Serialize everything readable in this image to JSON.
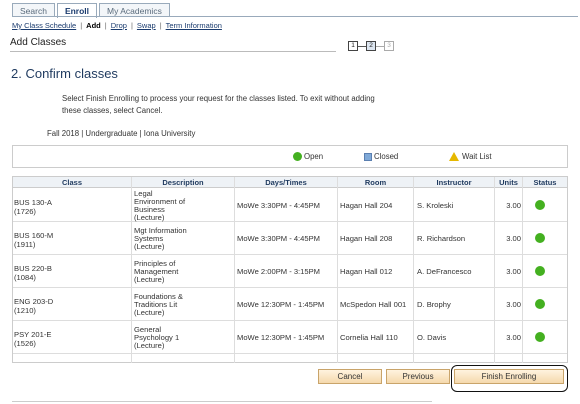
{
  "tabs": [
    {
      "label": "Search",
      "active": false
    },
    {
      "label": "Enroll",
      "active": true
    },
    {
      "label": "My Academics",
      "active": false
    }
  ],
  "subnav": [
    {
      "label": "My Class Schedule",
      "active": false
    },
    {
      "label": "Add",
      "active": true
    },
    {
      "label": "Drop",
      "active": false
    },
    {
      "label": "Swap",
      "active": false
    },
    {
      "label": "Term Information",
      "active": false
    }
  ],
  "page": {
    "section_title": "Add Classes",
    "steps": [
      "1",
      "2",
      "3"
    ],
    "current_step": 2,
    "heading": "2.  Confirm classes",
    "instructions": "Select Finish Enrolling to process your request for the classes listed. To exit without adding these classes, select Cancel.",
    "term": "Fall 2018 | Undergraduate | Iona University"
  },
  "legend": {
    "open": "Open",
    "closed": "Closed",
    "waitlist": "Wait List"
  },
  "table": {
    "headers": {
      "class": "Class",
      "description": "Description",
      "days_times": "Days/Times",
      "room": "Room",
      "instructor": "Instructor",
      "units": "Units",
      "status": "Status"
    },
    "rows": [
      {
        "class": "BUS 130-A",
        "class_id": "(1726)",
        "description": [
          "Legal",
          "Environment of",
          "Business",
          "(Lecture)"
        ],
        "days_times": "MoWe 3:30PM - 4:45PM",
        "room": "Hagan Hall 204",
        "instructor": "S. Kroleski",
        "units": "3.00",
        "status": "Open"
      },
      {
        "class": "BUS 160-M",
        "class_id": "(1911)",
        "description": [
          "Mgt Information",
          "Systems",
          "(Lecture)"
        ],
        "days_times": "MoWe 3:30PM - 4:45PM",
        "room": "Hagan Hall 208",
        "instructor": "R. Richardson",
        "units": "3.00",
        "status": "Open"
      },
      {
        "class": "BUS 220-B",
        "class_id": "(1084)",
        "description": [
          "Principles of",
          "Management",
          "(Lecture)"
        ],
        "days_times": "MoWe 2:00PM - 3:15PM",
        "room": "Hagan Hall 012",
        "instructor": "A. DeFrancesco",
        "units": "3.00",
        "status": "Open"
      },
      {
        "class": "ENG 203-D",
        "class_id": "(1210)",
        "description": [
          "Foundations &",
          "Traditions Lit",
          "(Lecture)"
        ],
        "days_times": "MoWe 12:30PM - 1:45PM",
        "room": "McSpedon Hall 001",
        "instructor": "D. Brophy",
        "units": "3.00",
        "status": "Open"
      },
      {
        "class": "PSY 201-E",
        "class_id": "(1526)",
        "description": [
          "General",
          "Psychology 1",
          "(Lecture)"
        ],
        "days_times": "MoWe 12:30PM - 1:45PM",
        "room": "Cornelia Hall 110",
        "instructor": "O. Davis",
        "units": "3.00",
        "status": "Open"
      }
    ]
  },
  "buttons": {
    "cancel": "Cancel",
    "previous": "Previous",
    "finish": "Finish Enrolling"
  },
  "colors": {
    "open_green": "#44b020",
    "closed_blue": "#7fa9d8",
    "waitlist_yellow": "#e6b800",
    "heading_blue": "#1f3a5f"
  }
}
